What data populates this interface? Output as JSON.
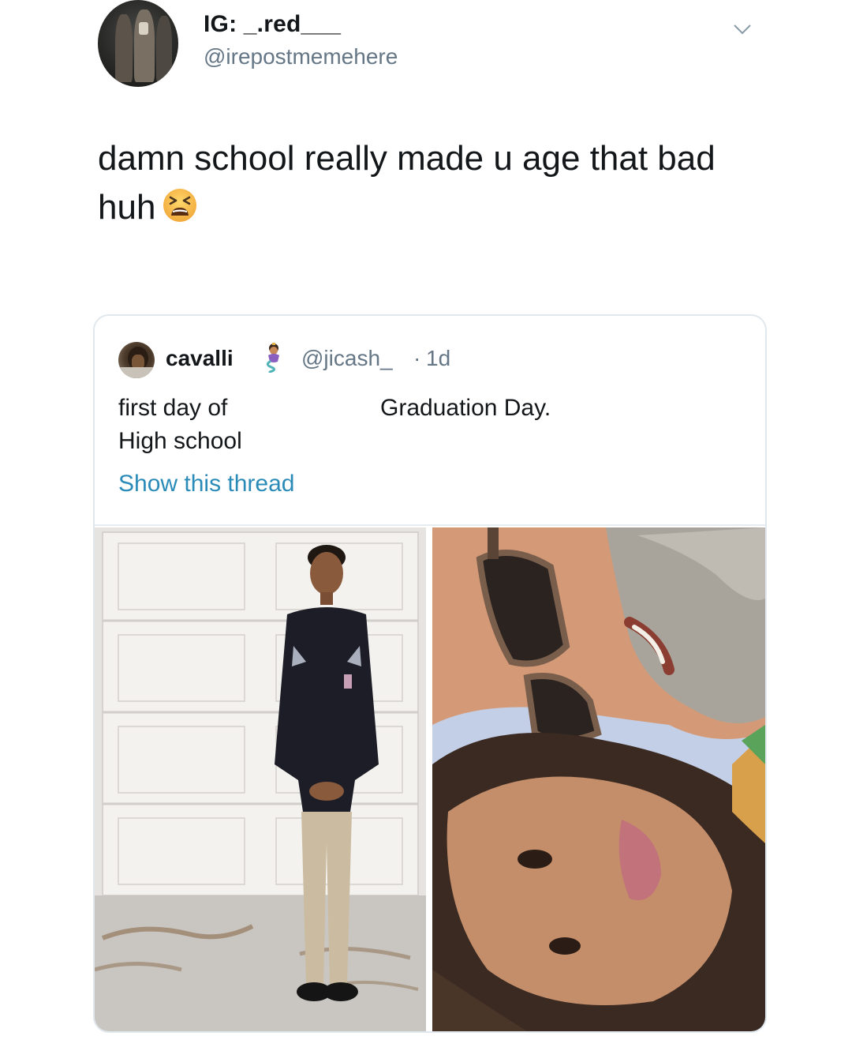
{
  "author": {
    "display_name": "IG: _.red___",
    "handle": "@irepostmemehere"
  },
  "tweet": {
    "text": "damn school really made u age that bad huh",
    "emoji_icon": "tired-face-emoji"
  },
  "quoted_tweet": {
    "display_name": "cavalli",
    "badge_icon": "genie-emoji",
    "handle": "@jicash_",
    "separator": "·",
    "time": "1d",
    "caption_left": "first day of\nHigh school",
    "caption_right": "Graduation Day.",
    "thread_link": "Show this thread",
    "images": [
      {
        "icon": "boy-in-uniform-photo"
      },
      {
        "icon": "selfie-photo"
      }
    ]
  },
  "colors": {
    "text": "#14171a",
    "secondary": "#657786",
    "link": "#2a8bb8",
    "border": "#e1e8ed"
  }
}
